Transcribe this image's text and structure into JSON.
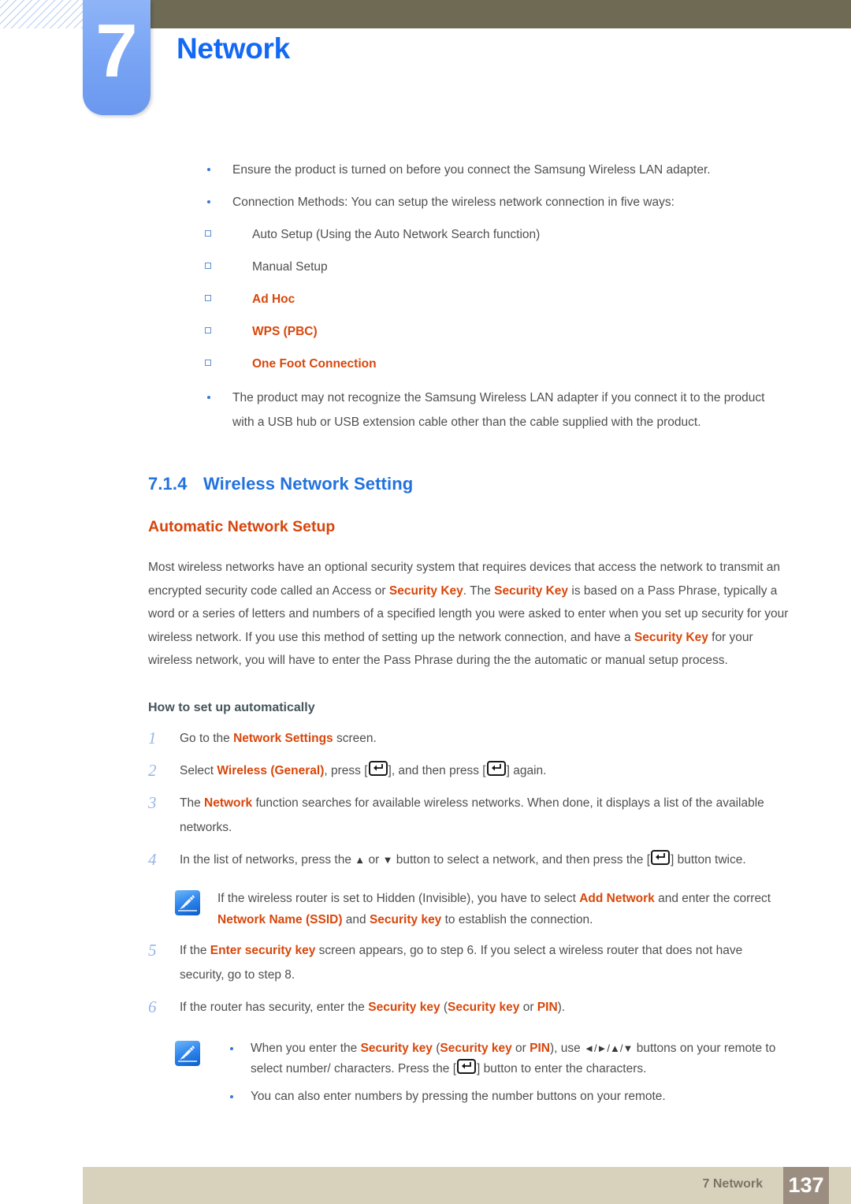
{
  "header": {
    "chapter_number": "7",
    "chapter_title": "Network",
    "accent_blue": "#1368f5",
    "olive_bar_color": "#6e6a53"
  },
  "intro_bullets": [
    {
      "level": 1,
      "text": "Ensure the product is turned on before you connect the Samsung Wireless LAN adapter."
    },
    {
      "level": 1,
      "text": "Connection Methods: You can setup the wireless network connection in five ways:"
    }
  ],
  "connection_methods": [
    {
      "label": "Auto Setup (Using the Auto Network Search function)",
      "highlighted": false
    },
    {
      "label": "Manual Setup",
      "highlighted": false
    },
    {
      "label": "Ad Hoc",
      "highlighted": true
    },
    {
      "label": "WPS (PBC)",
      "highlighted": true
    },
    {
      "label": "One Foot Connection",
      "highlighted": true
    }
  ],
  "closing_bullet": {
    "text": "The product may not recognize the Samsung Wireless LAN adapter if you connect it to the product with a USB hub or USB extension cable other than the cable supplied with the product."
  },
  "section": {
    "number": "7.1.4",
    "title": "Wireless Network Setting",
    "subheading": "Automatic Network Setup"
  },
  "body_paragraph": {
    "p1": "Most wireless networks have an optional security system that requires devices that access the network to transmit an encrypted security code called an Access or ",
    "term1": "Security Key",
    "p2": ". The ",
    "term2": "Security Key",
    "p3": " is based on a Pass Phrase, typically a word or a series of letters and numbers of a specified length you were asked to enter when you set up security for your wireless network. If you use this method of setting up the network connection, and have a ",
    "term3": "Security Key",
    "p4": " for your wireless network, you will have to enter the Pass Phrase during the the automatic or manual setup process."
  },
  "howto": {
    "heading": "How to set up automatically",
    "steps": [
      {
        "num": "1",
        "parts": [
          {
            "t": "Go to the ",
            "hl": false
          },
          {
            "t": "Network Settings",
            "hl": true
          },
          {
            "t": " screen.",
            "hl": false
          }
        ]
      },
      {
        "num": "2",
        "parts": [
          {
            "t": "Select ",
            "hl": false
          },
          {
            "t": "Wireless (General)",
            "hl": true
          },
          {
            "t": ", press [",
            "hl": false
          },
          {
            "t": "ENTER_KEY",
            "icon": true
          },
          {
            "t": "], and then press [",
            "hl": false
          },
          {
            "t": "ENTER_KEY",
            "icon": true
          },
          {
            "t": "] again.",
            "hl": false
          }
        ]
      },
      {
        "num": "3",
        "parts": [
          {
            "t": "The ",
            "hl": false
          },
          {
            "t": "Network",
            "hl": true
          },
          {
            "t": " function searches for available wireless networks. When done, it displays a list of the available networks.",
            "hl": false
          }
        ]
      },
      {
        "num": "4",
        "parts": [
          {
            "t": "In the list of networks, press the ",
            "hl": false
          },
          {
            "t": "▲",
            "arrow": true
          },
          {
            "t": " or ",
            "hl": false
          },
          {
            "t": "▼",
            "arrow": true
          },
          {
            "t": " button to select a network, and then press the [",
            "hl": false
          },
          {
            "t": "ENTER_KEY",
            "icon": true
          },
          {
            "t": "] button twice.",
            "hl": false
          }
        ]
      },
      {
        "num": "5",
        "parts": [
          {
            "t": "If the ",
            "hl": false
          },
          {
            "t": "Enter security key",
            "hl": true
          },
          {
            "t": " screen appears, go to step 6. If you select a wireless router that does not have security, go to step 8.",
            "hl": false
          }
        ]
      },
      {
        "num": "6",
        "parts": [
          {
            "t": "If the router has security, enter the ",
            "hl": false
          },
          {
            "t": "Security key",
            "hl": true
          },
          {
            "t": " (",
            "hl": false
          },
          {
            "t": "Security key",
            "hl": true
          },
          {
            "t": " or ",
            "hl": false
          },
          {
            "t": "PIN",
            "hl": true
          },
          {
            "t": ").",
            "hl": false
          }
        ]
      }
    ]
  },
  "note_after_step4": {
    "icon": "note-pen-icon",
    "parts": [
      {
        "t": "If the wireless router is set to Hidden (Invisible), you have to select ",
        "hl": false
      },
      {
        "t": "Add Network",
        "hl": true
      },
      {
        "t": " and enter the correct ",
        "hl": false
      },
      {
        "t": "Network Name (SSID)",
        "hl": true
      },
      {
        "t": " and ",
        "hl": false
      },
      {
        "t": "Security key",
        "hl": true
      },
      {
        "t": " to establish the connection.",
        "hl": false
      }
    ]
  },
  "note_after_step6": {
    "icon": "note-pen-icon",
    "bullets": [
      {
        "parts": [
          {
            "t": "When you enter the ",
            "hl": false
          },
          {
            "t": "Security key",
            "hl": true
          },
          {
            "t": " (",
            "hl": false
          },
          {
            "t": "Security key",
            "hl": true
          },
          {
            "t": " or ",
            "hl": false
          },
          {
            "t": "PIN",
            "hl": true
          },
          {
            "t": "), use ",
            "hl": false
          },
          {
            "t": "◄/►/▲/▼",
            "arrow": true
          },
          {
            "t": " buttons on your remote to select number/ characters. Press the [",
            "hl": false
          },
          {
            "t": "ENTER_KEY",
            "icon": true
          },
          {
            "t": "] button to enter the characters.",
            "hl": false
          }
        ]
      },
      {
        "parts": [
          {
            "t": "You can also enter numbers by pressing the number buttons on your remote.",
            "hl": false
          }
        ]
      }
    ]
  },
  "footer": {
    "label": "7 Network",
    "page_number": "137",
    "bar_color": "#d8d2bd",
    "page_box_color": "#9b8e80"
  },
  "colors": {
    "highlight_orange": "#d8470b",
    "heading_blue": "#2272dd",
    "subheading_orange": "#d6450c",
    "step_number_blue": "#96b6e8",
    "bullet_blue": "#3b74d6",
    "body_text": "#4f4f4f"
  }
}
